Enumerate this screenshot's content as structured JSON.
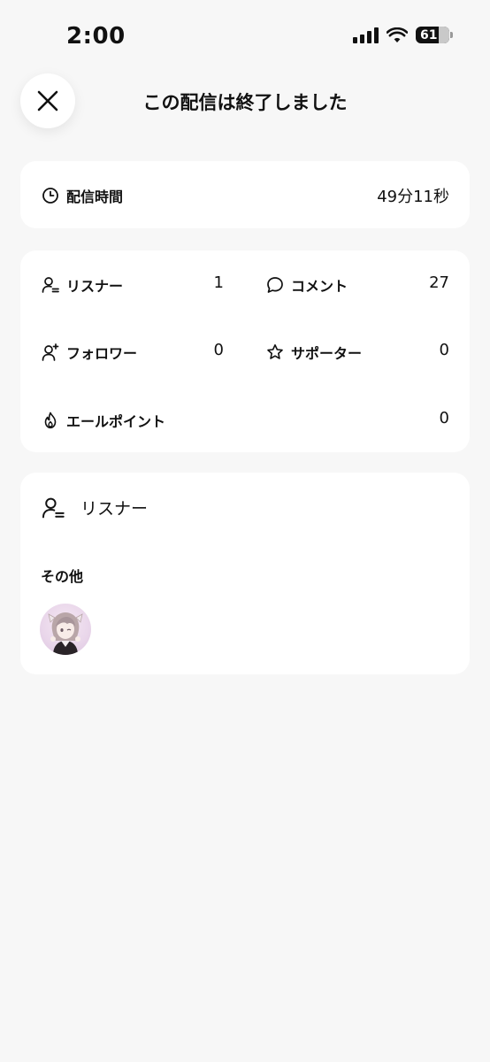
{
  "status_bar": {
    "time": "2:00",
    "battery": "61"
  },
  "header": {
    "title": "この配信は終了しました"
  },
  "duration": {
    "label": "配信時間",
    "value": "49分11秒"
  },
  "stats": {
    "listeners": {
      "label": "リスナー",
      "value": "1"
    },
    "comments": {
      "label": "コメント",
      "value": "27"
    },
    "followers": {
      "label": "フォロワー",
      "value": "0"
    },
    "supporters": {
      "label": "サポーター",
      "value": "0"
    },
    "cheer_points": {
      "label": "エールポイント",
      "value": "0"
    }
  },
  "listener_section": {
    "title": "リスナー",
    "group_label": "その他"
  },
  "icons": {
    "close": "close-icon",
    "clock": "clock-icon",
    "listener": "user-list-icon",
    "comment": "comment-bubble-icon",
    "follower": "user-plus-icon",
    "supporter": "star-icon",
    "cheer": "flame-icon"
  }
}
